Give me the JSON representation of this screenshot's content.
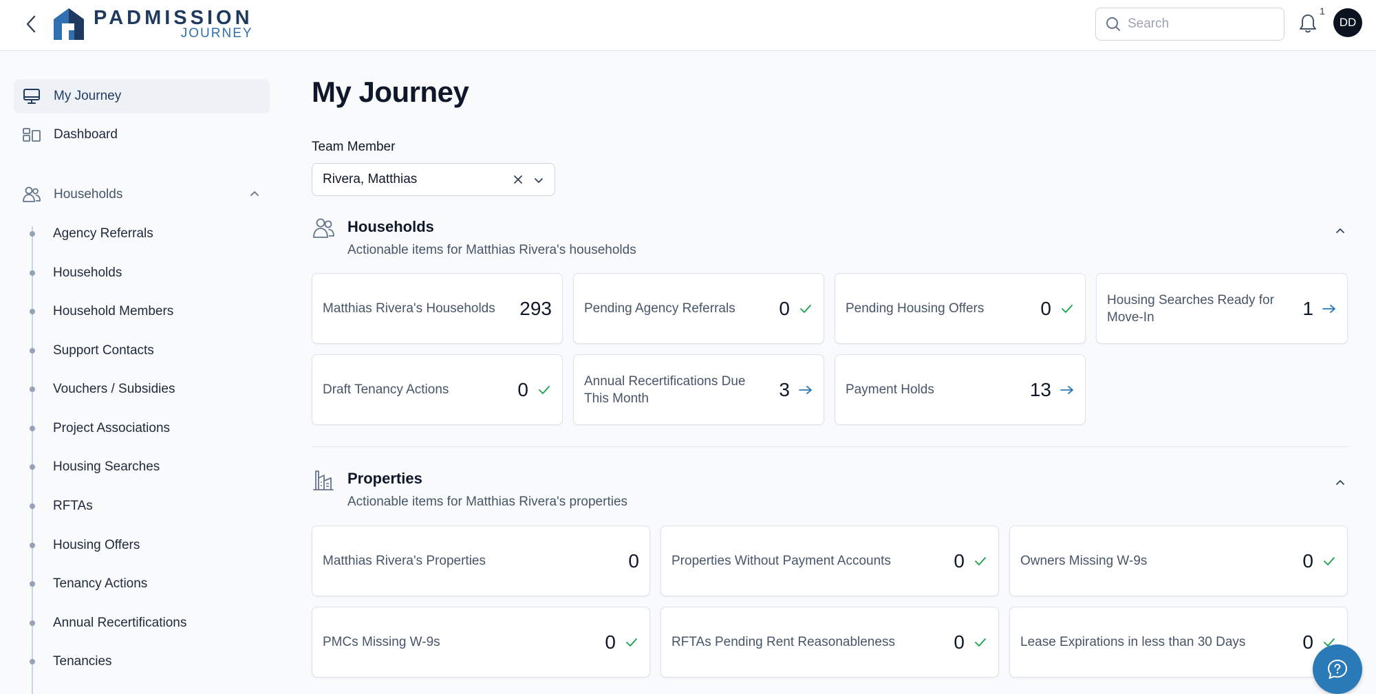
{
  "header": {
    "logo_main": "PADMISSION",
    "logo_sub": "JOURNEY",
    "search_placeholder": "Search",
    "notification_count": "1",
    "avatar_initials": "DD"
  },
  "sidebar": {
    "top_items": [
      {
        "label": "My Journey",
        "icon": "monitor-icon",
        "active": true
      },
      {
        "label": "Dashboard",
        "icon": "dashboard-icon",
        "active": false
      }
    ],
    "group": {
      "label": "Households",
      "icon": "users-icon",
      "expanded": true
    },
    "sub_items": [
      {
        "label": "Agency Referrals"
      },
      {
        "label": "Households"
      },
      {
        "label": "Household Members"
      },
      {
        "label": "Support Contacts"
      },
      {
        "label": "Vouchers / Subsidies"
      },
      {
        "label": "Project Associations"
      },
      {
        "label": "Housing Searches"
      },
      {
        "label": "RFTAs"
      },
      {
        "label": "Housing Offers"
      },
      {
        "label": "Tenancy Actions"
      },
      {
        "label": "Annual Recertifications"
      },
      {
        "label": "Tenancies"
      }
    ]
  },
  "main": {
    "title": "My Journey",
    "team_member_label": "Team Member",
    "team_member_value": "Rivera, Matthias",
    "households": {
      "title": "Households",
      "subtitle": "Actionable items for Matthias Rivera's households",
      "cards": [
        {
          "label": "Matthias Rivera's Households",
          "value": "293",
          "status": "none"
        },
        {
          "label": "Pending Agency Referrals",
          "value": "0",
          "status": "check"
        },
        {
          "label": "Pending Housing Offers",
          "value": "0",
          "status": "check"
        },
        {
          "label": "Housing Searches Ready for Move-In",
          "value": "1",
          "status": "arrow"
        },
        {
          "label": "Draft Tenancy Actions",
          "value": "0",
          "status": "check"
        },
        {
          "label": "Annual Recertifications Due This Month",
          "value": "3",
          "status": "arrow"
        },
        {
          "label": "Payment Holds",
          "value": "13",
          "status": "arrow"
        }
      ]
    },
    "properties": {
      "title": "Properties",
      "subtitle": "Actionable items for Matthias Rivera's properties",
      "cards": [
        {
          "label": "Matthias Rivera's Properties",
          "value": "0",
          "status": "none"
        },
        {
          "label": "Properties Without Payment Accounts",
          "value": "0",
          "status": "check"
        },
        {
          "label": "Owners Missing W-9s",
          "value": "0",
          "status": "check"
        },
        {
          "label": "PMCs Missing W-9s",
          "value": "0",
          "status": "check"
        },
        {
          "label": "RFTAs Pending Rent Reasonableness",
          "value": "0",
          "status": "check"
        },
        {
          "label": "Lease Expirations in less than 30 Days",
          "value": "0",
          "status": "check"
        }
      ]
    }
  },
  "colors": {
    "check": "#16a34a",
    "arrow": "#2a7ab8",
    "brand": "#1e3a5f",
    "fab": "#2a7ab8"
  }
}
